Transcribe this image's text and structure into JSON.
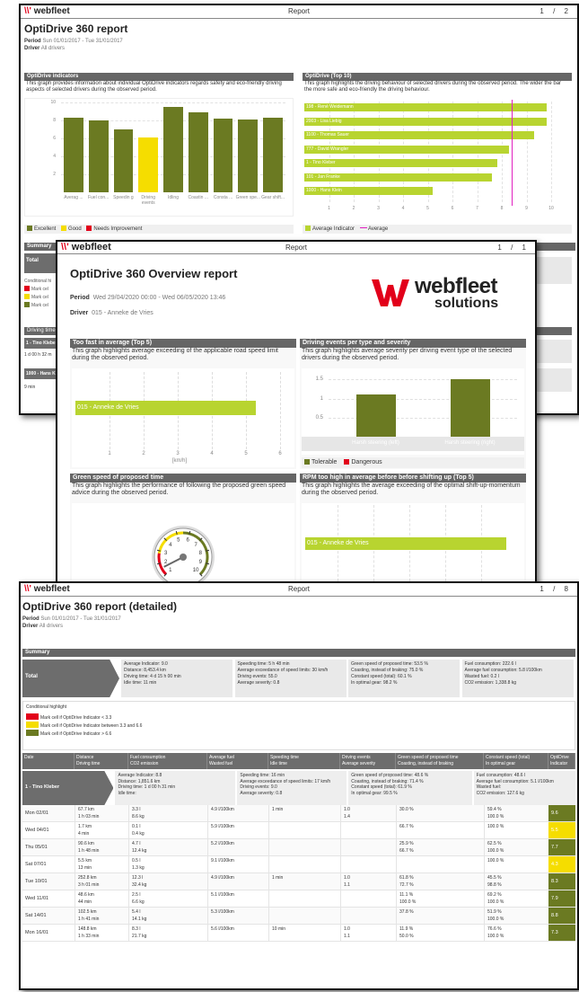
{
  "colors": {
    "excellent": "#6b7a22",
    "good": "#f5dd00",
    "needs_improvement": "#e2001a",
    "lime": "#b8d430",
    "average_line": "#e020c0"
  },
  "p1": {
    "logo": "webfleet",
    "report_label": "Report",
    "page_num": "1",
    "page_total": "2",
    "title": "OptiDrive 360 report",
    "period_label": "Period",
    "period": "Sun 01/01/2017 - Tue 31/01/2017",
    "driver_label": "Driver",
    "driver": "All drivers",
    "indicators": {
      "header": "OptiDrive indicators",
      "desc": "This graph provides information about individual OptiDrive indicators regards safety and eco-friendly driving aspects of selected drivers during the observed period."
    },
    "top10": {
      "header": "OptiDrive (Top 10)",
      "desc": "This graph highlights the driving behaviour of selected drivers during the observed period. The wider the bar the more safe and eco-friendly the driving behaviour."
    },
    "legend": {
      "excellent": "Excellent",
      "good": "Good",
      "needs": "Needs Improvement"
    },
    "top10_legend": {
      "avg_indicator": "Average Indicator",
      "average": "Average"
    },
    "summary": "Summary",
    "total": "Total",
    "conditional": "Conditional hi",
    "mark": "Mark cel",
    "driving_time": "Driving time",
    "tino": "1 - Tino Klebe",
    "tino_val": "1 d 00 h 32 m",
    "hans": "1000 - Hans K",
    "hans_val": "9 min"
  },
  "chart_data": [
    {
      "type": "bar",
      "title": "OptiDrive indicators",
      "ylim": [
        0,
        10
      ],
      "yticks": [
        "2",
        "4",
        "6",
        "8",
        "10"
      ],
      "categories": [
        "Averag ...",
        "Fuel con...",
        "Speedin g",
        "Driving events",
        "Idling",
        "Coastin ...",
        "Consta ...",
        "Green spe...",
        "Gear shift..."
      ],
      "values": [
        8.3,
        8.0,
        7.0,
        6.1,
        9.5,
        8.9,
        8.2,
        8.1,
        8.3
      ],
      "colors": [
        "excellent",
        "excellent",
        "excellent",
        "good",
        "excellent",
        "excellent",
        "excellent",
        "excellent",
        "excellent"
      ]
    },
    {
      "type": "bar",
      "orientation": "horizontal",
      "title": "OptiDrive (Top 10)",
      "xlim": [
        0,
        10
      ],
      "xticks": [
        "1",
        "2",
        "3",
        "4",
        "5",
        "6",
        "7",
        "8",
        "9",
        "10"
      ],
      "categories": [
        "198 - René Weidemann",
        "2003 - Lisa Liebig",
        "1100 - Thomas Sauer",
        "777 - David Wrangler",
        "1 - Tino Kleber",
        "101 - Jan Franke",
        "1000 - Hans Klein"
      ],
      "values": [
        9.8,
        9.8,
        9.3,
        8.3,
        7.8,
        7.6,
        5.2
      ],
      "average": 8.4
    },
    {
      "type": "bar",
      "orientation": "horizontal",
      "title": "Too fast in average (Top 5)",
      "xlim": [
        0,
        6
      ],
      "xticks": [
        "1",
        "2",
        "3",
        "4",
        "5",
        "6"
      ],
      "xlabel": "[km/h]",
      "categories": [
        "015 - Anneke de Vries"
      ],
      "values": [
        5.3
      ]
    },
    {
      "type": "bar",
      "title": "Driving events per type and severity",
      "ylim": [
        0,
        1.7
      ],
      "yticks": [
        "0.5",
        "1",
        "1.5"
      ],
      "categories": [
        "Harsh steering (left)",
        "Harsh steering (right)"
      ],
      "values": [
        1.1,
        1.5
      ],
      "series": [
        {
          "name": "Tolerable"
        },
        {
          "name": "Dangerous"
        }
      ]
    },
    {
      "type": "bar",
      "orientation": "horizontal",
      "title": "RPM too high in average before before shifting up (Top 5)",
      "categories": [
        "015 - Anneke de Vries"
      ],
      "values": [
        0.95
      ]
    }
  ],
  "p2": {
    "report_label": "Report",
    "page_num": "1",
    "page_total": "1",
    "title": "OptiDrive 360 Overview report",
    "period_label": "Period",
    "period": "Wed 29/04/2020 00:00 - Wed 06/05/2020 13:46",
    "driver_label": "Driver",
    "driver": "015 - Anneke de Vries",
    "logo_main": "webfleet",
    "logo_sub": "solutions",
    "toofast": {
      "header": "Too fast in average (Top 5)",
      "desc": "This graph highlights average exceeding of the applicable road speed limit during the observed period."
    },
    "events": {
      "header": "Driving events per type and severity",
      "desc": "This graph highlights average severity per driving event type of the selected drivers during the observed period."
    },
    "green": {
      "header": "Green speed of proposed time",
      "desc": "This graph highlights the performance of following the proposed green speed advice during the observed period."
    },
    "rpm": {
      "header": "RPM too high in average before before shifting up (Top 5)",
      "desc": "This graph highlights the average exceeding of the optimal shift-up-momentum during the observed period."
    },
    "gauge_ticks": [
      "1",
      "2",
      "3",
      "4",
      "5",
      "6",
      "7",
      "8",
      "9",
      "10"
    ]
  },
  "p3": {
    "logo": "webfleet",
    "report_label": "Report",
    "page_num": "1",
    "page_total": "8",
    "title": "OptiDrive 360 report (detailed)",
    "period_label": "Period",
    "period": "Sun 01/01/2017 - Tue 31/01/2017",
    "driver_label": "Driver",
    "driver": "All drivers",
    "summary": "Summary",
    "total": "Total",
    "summary_cols": [
      [
        "Average Indicator: 9.0",
        "Distance: 8,453.4 km",
        "Driving time: 4 d 15 h 00 min",
        "Idle time: 11 min"
      ],
      [
        "Speeding time: 5 h 48 min",
        "Average exceedance of speed limits: 30 km/h",
        "Driving events: 55.0",
        "Average severity: 0.8"
      ],
      [
        "Green speed of proposed time: 53.5 %",
        "Coasting, instead of braking: 75.0 %",
        "Constant speed (total): 60.1 %",
        "In optimal gear: 98.2 %"
      ],
      [
        "Fuel consumption: 222.6 l",
        "Average fuel consumption: 5.8 l/100km",
        "Wasted fuel: 0.2 l",
        "CO2 emission: 1,338.8 kg"
      ]
    ],
    "cond_title": "Conditional highlight",
    "cond": [
      "Mark cell if OptiDrive Indicator < 3.3",
      "Mark cell if OptiDrive Indicator between 3.3 and 6.6",
      "Mark cell if OptiDrive Indicator > 6.6"
    ],
    "cols": [
      [
        "Date",
        ""
      ],
      [
        "Distance",
        "Driving time"
      ],
      [
        "Fuel consumption",
        "CO2 emission"
      ],
      [
        "Average fuel",
        "Wasted fuel"
      ],
      [
        "Speeding time",
        "Idle time"
      ],
      [
        "Driving events",
        "Average severity"
      ],
      [
        "Green speed of proposed time",
        "Coasting, instead of braking"
      ],
      [
        "Constant speed (total)",
        "In optimal gear"
      ],
      [
        "OptiDrive",
        "Indicator"
      ]
    ],
    "driver_name": "1 - Tino Kleber",
    "driver_cols": [
      [
        "Average Indicator: 8.8",
        "Distance: 1,851.6 km",
        "Driving time: 1 d 00 h 31 min",
        "Idle time:"
      ],
      [
        "Speeding time: 16 min",
        "Average exceedance of speed limits: 17 km/h",
        "Driving events: 9.0",
        "Average severity: 0.8"
      ],
      [
        "Green speed of proposed time: 48.6 %",
        "Coasting, instead of braking: 71.4 %",
        "Constant speed (total): 61.9 %",
        "In optimal gear: 99.5 %"
      ],
      [
        "Fuel consumption: 48.6 l",
        "Average fuel consumption: 5.1 l/100km",
        "Wasted fuel:",
        "CO2 emission: 127.6 kg"
      ]
    ],
    "rows": [
      {
        "date": "Mon 02/01",
        "c": [
          [
            "67.7 km",
            "1 h 03 min"
          ],
          [
            "3.3 l",
            "8.6 kg"
          ],
          [
            "4.9 l/100km",
            ""
          ],
          [
            "1 min",
            ""
          ],
          [
            "1.0",
            "1.4"
          ],
          [
            "30.0 %",
            ""
          ],
          [
            "59.4 %",
            "100.0 %"
          ]
        ],
        "ind": "9.6",
        "lvl": "excellent"
      },
      {
        "date": "Wed 04/01",
        "c": [
          [
            "1.7 km",
            "4 min"
          ],
          [
            "0.1 l",
            "0.4 kg"
          ],
          [
            "5.9 l/100km",
            ""
          ],
          [
            "",
            ""
          ],
          [
            "",
            ""
          ],
          [
            "",
            "66.7 %"
          ],
          [
            "",
            "100.0 %"
          ]
        ],
        "ind": "5.5",
        "lvl": "good"
      },
      {
        "date": "Thu 05/01",
        "c": [
          [
            "90.6 km",
            "1 h 48 min"
          ],
          [
            "4.7 l",
            "12.4 kg"
          ],
          [
            "5.2 l/100km",
            ""
          ],
          [
            "",
            ""
          ],
          [
            "",
            ""
          ],
          [
            "25.9 %",
            "66.7 %"
          ],
          [
            "62.5 %",
            "100.0 %"
          ]
        ],
        "ind": "7.7",
        "lvl": "excellent"
      },
      {
        "date": "Sat 07/01",
        "c": [
          [
            "5.5 km",
            "13 min"
          ],
          [
            "0.5 l",
            "1.3 kg"
          ],
          [
            "9.1 l/100km",
            ""
          ],
          [
            "",
            ""
          ],
          [
            "",
            ""
          ],
          [
            "",
            ""
          ],
          [
            "",
            "100.0 %"
          ]
        ],
        "ind": "4.3",
        "lvl": "good"
      },
      {
        "date": "Tue 10/01",
        "c": [
          [
            "252.8 km",
            "3 h 01 min"
          ],
          [
            "12.3 l",
            "32.4 kg"
          ],
          [
            "4.9 l/100km",
            ""
          ],
          [
            "1 min",
            ""
          ],
          [
            "1.0",
            "1.1"
          ],
          [
            "61.8 %",
            "72.7 %"
          ],
          [
            "45.5 %",
            "98.8 %"
          ]
        ],
        "ind": "8.3",
        "lvl": "excellent"
      },
      {
        "date": "Wed 11/01",
        "c": [
          [
            "48.6 km",
            "44 min"
          ],
          [
            "2.5 l",
            "6.6 kg"
          ],
          [
            "5.1 l/100km",
            ""
          ],
          [
            "",
            ""
          ],
          [
            "",
            ""
          ],
          [
            "11.1 %",
            "100.0 %"
          ],
          [
            "69.2 %",
            "100.0 %"
          ]
        ],
        "ind": "7.9",
        "lvl": "excellent"
      },
      {
        "date": "Sat 14/01",
        "c": [
          [
            "102.5 km",
            "1 h 41 min"
          ],
          [
            "5.4 l",
            "14.1 kg"
          ],
          [
            "5.3 l/100km",
            ""
          ],
          [
            "",
            ""
          ],
          [
            "",
            ""
          ],
          [
            "37.8 %",
            ""
          ],
          [
            "51.9 %",
            "100.0 %"
          ]
        ],
        "ind": "8.8",
        "lvl": "excellent"
      },
      {
        "date": "Mon 16/01",
        "c": [
          [
            "148.8 km",
            "1 h 33 min"
          ],
          [
            "8.3 l",
            "21.7 kg"
          ],
          [
            "5.6 l/100km",
            ""
          ],
          [
            "10 min",
            ""
          ],
          [
            "1.0",
            "1.1"
          ],
          [
            "11.9 %",
            "50.0 %"
          ],
          [
            "76.6 %",
            "100.0 %"
          ]
        ],
        "ind": "7.3",
        "lvl": "excellent"
      }
    ]
  }
}
